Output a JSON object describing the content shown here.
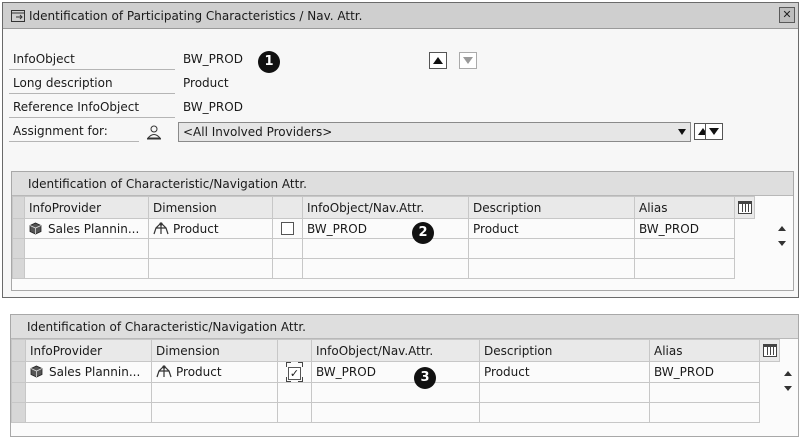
{
  "dialog": {
    "title": "Identification of Participating Characteristics / Nav. Attr."
  },
  "form": {
    "infoobject_label": "InfoObject",
    "infoobject_value": "BW_PROD",
    "long_desc_label": "Long description",
    "long_desc_value": "Product",
    "reference_label": "Reference InfoObject",
    "reference_value": "BW_PROD",
    "assignment_label": "Assignment for:",
    "assignment_value": "<All Involved Providers>"
  },
  "markers": [
    "1",
    "2",
    "3"
  ],
  "grid": {
    "title": "Identification of Characteristic/Navigation Attr.",
    "columns": [
      "InfoProvider",
      "Dimension",
      "",
      "InfoObject/Nav.Attr.",
      "Description",
      "Alias"
    ],
    "row": {
      "infoprovider": "Sales Plannin...",
      "dimension": "Product",
      "infoobject": "BW_PROD",
      "description": "Product",
      "alias": "BW_PROD"
    },
    "checked_top": false,
    "checked_bottom": true
  },
  "icons": {
    "title": "dialog-window-icon",
    "cube": "infocube-icon",
    "dimension": "dimension-icon",
    "assignment": "person-icon",
    "column_settings": "column-settings-icon"
  },
  "colors": {
    "titlebar": "#cfcfcf",
    "grid_header": "#e9e9e9",
    "marker": "#111111"
  }
}
